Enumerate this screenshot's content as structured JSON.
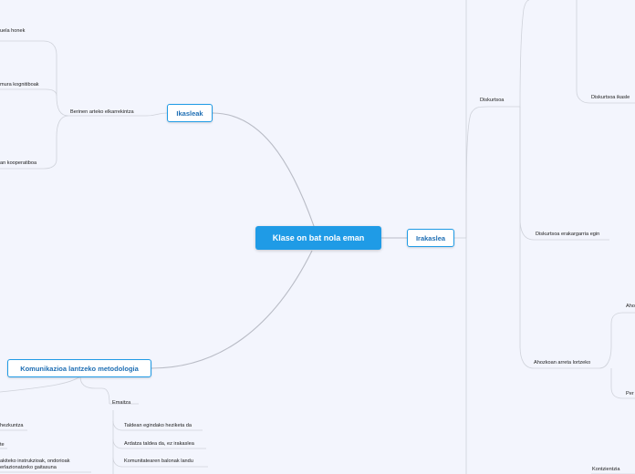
{
  "central": "Klase on bat nola eman",
  "main_nodes": {
    "ikasleak": "Ikasleak",
    "irakaslea": "Irakaslea",
    "komunikazioa": "Komunikazioa lantzeko metodologia"
  },
  "ikasleak_branch": {
    "berinen": "Berinen arteko elkarrekintza",
    "leaf1": "uela honek",
    "leaf2": "mura kognitiboak",
    "leaf3": "an kooperatiboa"
  },
  "irakaslea_branch": {
    "diskurtsoa": "Diskurtsoa",
    "diskurtsoa_ikasle": "Diskurtsoa ikasle",
    "erakargarria": "Diskurtsoa erakargarria egin",
    "ahozkoan": "Ahozkoan arreta lortzeko",
    "aho": "Aho",
    "per": "Per",
    "kontzientzia": "Kontzientzia"
  },
  "komunikazioa_branch": {
    "emaitza": "Emaitza",
    "taldean": "Taldean egindako heziketa da",
    "ardatza": "Ardatza taldea da, ez irakaslea",
    "komunitatearen": "Komunitatearen balonak landu",
    "hezkuntza": "hezkuntza",
    "te": "te",
    "akiteko": "akiteko instrukzioak, ondorioak",
    "erlazionatzeko": "erlazionatzeko gaitasuna"
  }
}
